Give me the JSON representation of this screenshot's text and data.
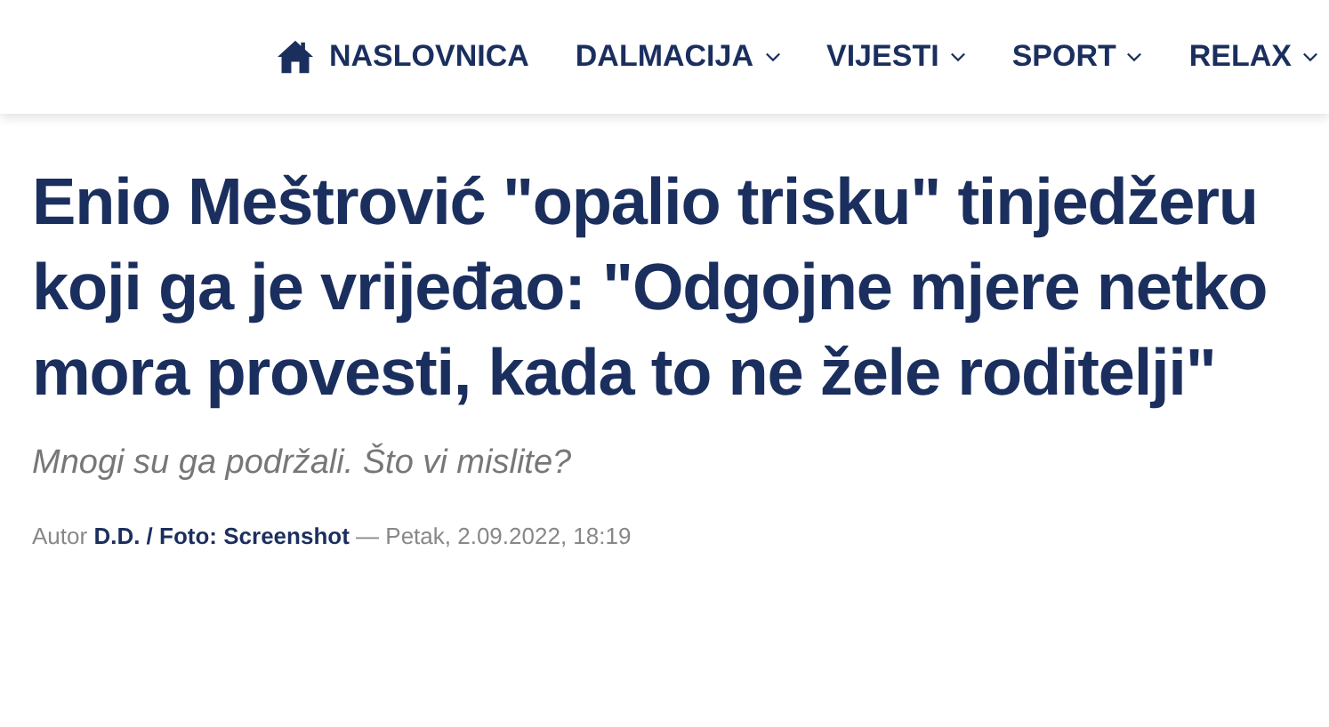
{
  "nav": [
    {
      "label": "NASLOVNICA",
      "kind": "home"
    },
    {
      "label": "DALMACIJA",
      "kind": "dropdown"
    },
    {
      "label": "VIJESTI",
      "kind": "dropdown"
    },
    {
      "label": "SPORT",
      "kind": "dropdown"
    },
    {
      "label": "RELAX",
      "kind": "dropdown"
    }
  ],
  "article": {
    "title": "Enio Meštrović \"opalio trisku\" tinjedžeru koji ga je vrijeđao: \"Odgojne mjere netko mora provesti, kada to ne žele roditelji\"",
    "subtitle": "Mnogi su ga podržali. Što vi mislite?",
    "byline": "Autor **D.D. / Foto: Screenshot** — Petak, 2.09.2022, 18:19"
  }
}
